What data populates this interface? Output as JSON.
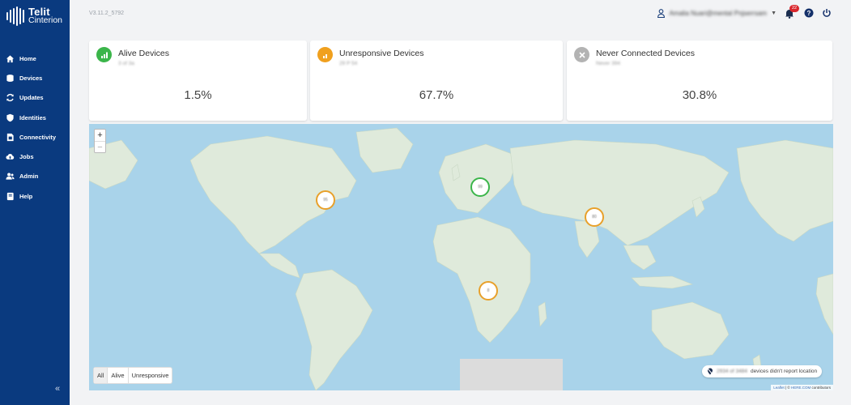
{
  "app": {
    "logo_line1": "Telit",
    "logo_line2": "Cinterion",
    "version": "V3.11.2_5792"
  },
  "sidebar": {
    "items": [
      {
        "label": "Home",
        "icon": "home-icon"
      },
      {
        "label": "Devices",
        "icon": "devices-icon"
      },
      {
        "label": "Updates",
        "icon": "refresh-icon"
      },
      {
        "label": "Identities",
        "icon": "shield-icon"
      },
      {
        "label": "Connectivity",
        "icon": "sim-icon"
      },
      {
        "label": "Jobs",
        "icon": "cloud-upload-icon"
      },
      {
        "label": "Admin",
        "icon": "users-icon"
      },
      {
        "label": "Help",
        "icon": "book-icon"
      }
    ],
    "collapse_glyph": "«"
  },
  "header": {
    "user_name": "Amalia Nuari@mental Pnjserrsam",
    "notifications_count": "22"
  },
  "cards": {
    "alive": {
      "title": "Alive Devices",
      "subtitle": "3 of 3a",
      "value": "1.5%",
      "color": "#3bb54a"
    },
    "unresponsive": {
      "title": "Unresponsive Devices",
      "subtitle": "29 P 54",
      "value": "67.7%",
      "color": "#f0a01e"
    },
    "never": {
      "title": "Never Connected Devices",
      "subtitle": "Never 394",
      "value": "30.8%",
      "color": "#b3b3b3"
    }
  },
  "map": {
    "clusters": [
      {
        "label": "95",
        "status": "unresponsive",
        "color": "#e8a02a"
      },
      {
        "label": "99",
        "status": "alive",
        "color": "#3bb54a"
      },
      {
        "label": "80",
        "status": "unresponsive",
        "color": "#e8a02a"
      },
      {
        "label": "8",
        "status": "unresponsive",
        "color": "#e8a02a"
      }
    ],
    "filters": [
      "All",
      "Alive",
      "Unresponsive"
    ],
    "no_location_count": "2934 of 3484",
    "no_location_text": "devices didn't report location",
    "attribution_leaflet": "Leaflet",
    "attribution_sep": " | © ",
    "attribution_here": "HERE.COM",
    "attribution_rest": " contributors",
    "zoom_in": "+",
    "zoom_out": "−"
  }
}
